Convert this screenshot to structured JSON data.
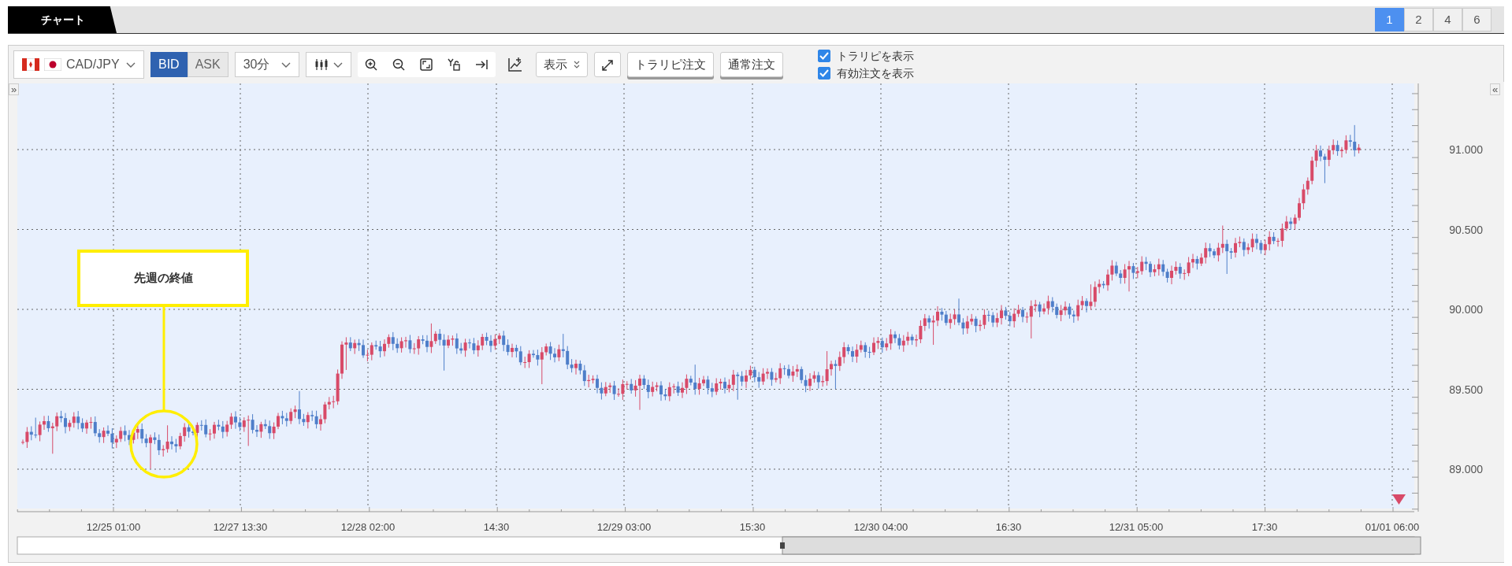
{
  "tabs": [
    {
      "label": "チャート",
      "selected": true
    }
  ],
  "layout_buttons": [
    {
      "label": "1",
      "selected": true
    },
    {
      "label": "2",
      "selected": false
    },
    {
      "label": "4",
      "selected": false
    },
    {
      "label": "6",
      "selected": false
    }
  ],
  "toolbar": {
    "pair": "CAD/JPY",
    "price_side": [
      {
        "label": "BID",
        "selected": true
      },
      {
        "label": "ASK",
        "selected": false
      }
    ],
    "timeframe": "30分",
    "display_menu": "表示",
    "order_buttons": [
      "トラリピ注文",
      "通常注文"
    ],
    "checkboxes": [
      {
        "label": "トラリピを表示",
        "checked": true
      },
      {
        "label": "有効注文を表示",
        "checked": true
      }
    ]
  },
  "chart": {
    "left_toggle": "»",
    "right_toggle": "«",
    "annotation": "先週の終値",
    "y_axis_labels": [
      "91.000",
      "90.500",
      "90.000",
      "89.500",
      "89.000"
    ],
    "x_axis_labels": [
      "12/25 01:00",
      "12/27 13:30",
      "12/28 02:00",
      "14:30",
      "12/29 03:00",
      "15:30",
      "12/30 04:00",
      "16:30",
      "12/31 05:00",
      "17:30",
      "01/01 06:00"
    ]
  }
}
